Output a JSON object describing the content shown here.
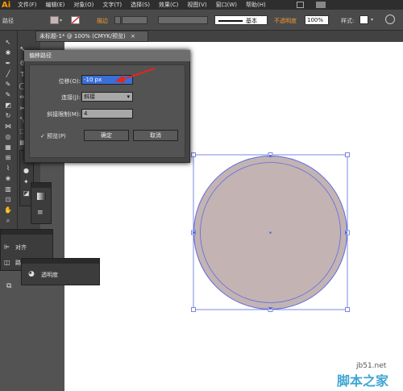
{
  "menubar": {
    "logo": "Ai",
    "items": [
      "文件(F)",
      "编辑(E)",
      "对象(O)",
      "文字(T)",
      "选择(S)",
      "效果(C)",
      "视图(V)",
      "窗口(W)",
      "帮助(H)"
    ]
  },
  "controlbar": {
    "mode_label": "路径",
    "stroke_label": "描边",
    "basic_label": "基本",
    "opacity_label": "不透明度",
    "opacity_value": "100%",
    "style_label": "样式:"
  },
  "document": {
    "tab_title": "未标题-1* @ 100% (CMYK/预览)",
    "tab_close": "×"
  },
  "dialog": {
    "title": "偏移路径",
    "offset_label": "位移(O):",
    "offset_value": "-10 px",
    "joins_label": "连接(J):",
    "joins_value": "斜接",
    "miter_label": "斜接限制(M):",
    "miter_value": "4",
    "preview_label": "✓ 预览(P)",
    "ok_label": "确定",
    "cancel_label": "取消"
  },
  "panels": {
    "align_label": "对齐",
    "pathfinder_label": "路径查找器",
    "transparency_label": "透明度"
  },
  "artwork": {
    "fill_color": "#c3b3b3",
    "selection_color": "#5b6be0",
    "arrow_color": "#e0281c"
  },
  "watermark": {
    "url": "jb51.net",
    "text": "脚本之家"
  }
}
